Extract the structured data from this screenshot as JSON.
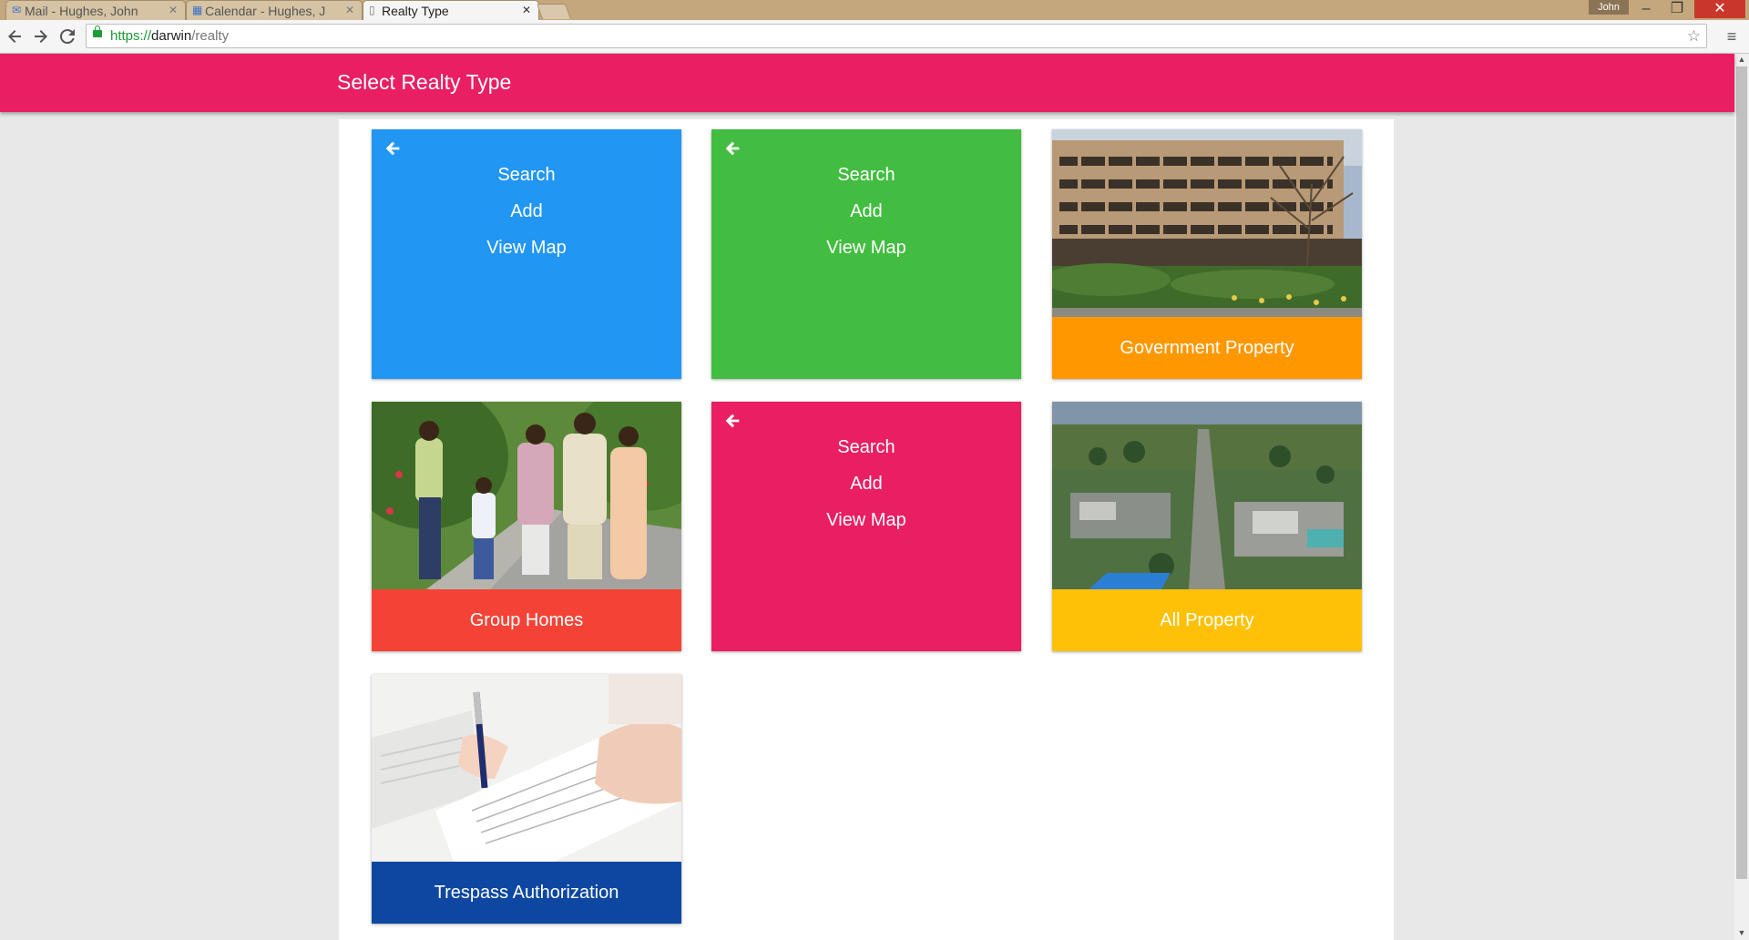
{
  "browser": {
    "tabs": [
      {
        "label": "Mail - Hughes, John",
        "icon": "mail-icon"
      },
      {
        "label": "Calendar - Hughes, J",
        "icon": "calendar-icon"
      },
      {
        "label": "Realty Type",
        "icon": "page-icon",
        "active": true
      }
    ],
    "profile_name": "John",
    "url": {
      "scheme": "https://",
      "host": "darwin",
      "path": "/realty"
    }
  },
  "header": {
    "title": "Select Realty Type",
    "color": "#e91e63"
  },
  "cards": {
    "blue": {
      "color": "#2196f3",
      "actions": [
        "Search",
        "Add",
        "View Map"
      ]
    },
    "green": {
      "color": "#42bd41",
      "actions": [
        "Search",
        "Add",
        "View Map"
      ]
    },
    "government": {
      "label": "Government Property",
      "color": "#ff9800",
      "image": "office-building-photo"
    },
    "group_homes": {
      "label": "Group Homes",
      "color": "#f44336",
      "image": "family-walking-photo"
    },
    "pink": {
      "color": "#e91e63",
      "actions": [
        "Search",
        "Add",
        "View Map"
      ]
    },
    "all_property": {
      "label": "All Property",
      "color": "#ffc107",
      "image": "aerial-town-photo"
    },
    "trespass": {
      "label": "Trespass Authorization",
      "color": "#0d47a1",
      "image": "signing-document-photo"
    }
  }
}
